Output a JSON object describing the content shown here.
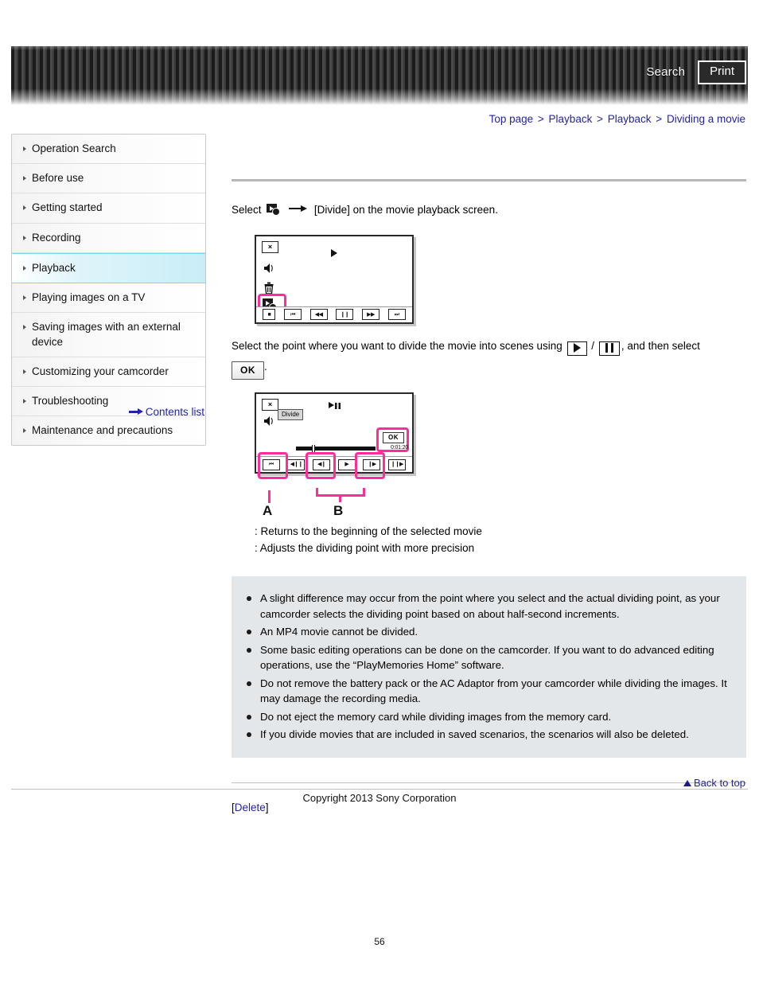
{
  "header": {
    "search_label": "Search",
    "print_label": "Print"
  },
  "breadcrumb": {
    "items": [
      "Top page",
      "Playback",
      "Playback",
      "Dividing a movie"
    ],
    "separator": ">"
  },
  "sidebar": {
    "items": [
      {
        "label": "Operation Search",
        "active": false
      },
      {
        "label": "Before use",
        "active": false
      },
      {
        "label": "Getting started",
        "active": false
      },
      {
        "label": "Recording",
        "active": false
      },
      {
        "label": "Playback",
        "active": true
      },
      {
        "label": "Playing images on a TV",
        "active": false
      },
      {
        "label": "Saving images with an external device",
        "active": false
      },
      {
        "label": "Customizing your camcorder",
        "active": false
      },
      {
        "label": "Troubleshooting",
        "active": false
      },
      {
        "label": "Maintenance and precautions",
        "active": false
      }
    ],
    "contents_list_label": "Contents list"
  },
  "main": {
    "step1": {
      "prefix": "Select",
      "suffix": "[Divide] on the movie playback screen."
    },
    "step2": {
      "part1": "Select the point where you want to divide the movie into scenes using",
      "separator": "/",
      "part2": ", and then select",
      "ok_label": "OK",
      "trailing": "."
    },
    "figure1": {
      "close_label": "×",
      "buttons": [
        "■",
        "⏮",
        "◀◀",
        "❙❙",
        "▶▶",
        "⏭"
      ],
      "highlight_color": "#ff2d9a"
    },
    "figure2": {
      "close_label": "×",
      "divide_tag": "Divide",
      "ok_label": "OK",
      "timecode": "0:01:20",
      "buttons": [
        "⏮",
        "◀❙❙",
        "◀❙",
        "▶",
        "❙▶",
        "❙❙▶"
      ],
      "callout_a": "A",
      "callout_b": "B",
      "highlight_color": "#ff2d9a"
    },
    "legend": [
      ": Returns to the beginning of the selected movie",
      ": Adjusts the dividing point with more precision"
    ],
    "notes": [
      "A slight difference may occur from the point where you select and the actual dividing point, as your camcorder selects the dividing point based on about half-second increments.",
      "An MP4 movie cannot be divided.",
      "Some basic editing operations can be done on the camcorder. If you want to do advanced editing operations, use the “PlayMemories Home” software.",
      "Do not remove the battery pack or the AC Adaptor from your camcorder while dividing the images. It may damage the recording media.",
      "Do not eject the memory card while dividing images from the memory card.",
      "If you divide movies that are included in saved scenarios, the scenarios will also be deleted."
    ],
    "related_link": {
      "open_bracket": "[",
      "label": "Delete",
      "close_bracket": "]"
    }
  },
  "footer": {
    "back_to_top_label": "Back to top",
    "copyright": "Copyright 2013 Sony Corporation",
    "page_number": "56"
  }
}
